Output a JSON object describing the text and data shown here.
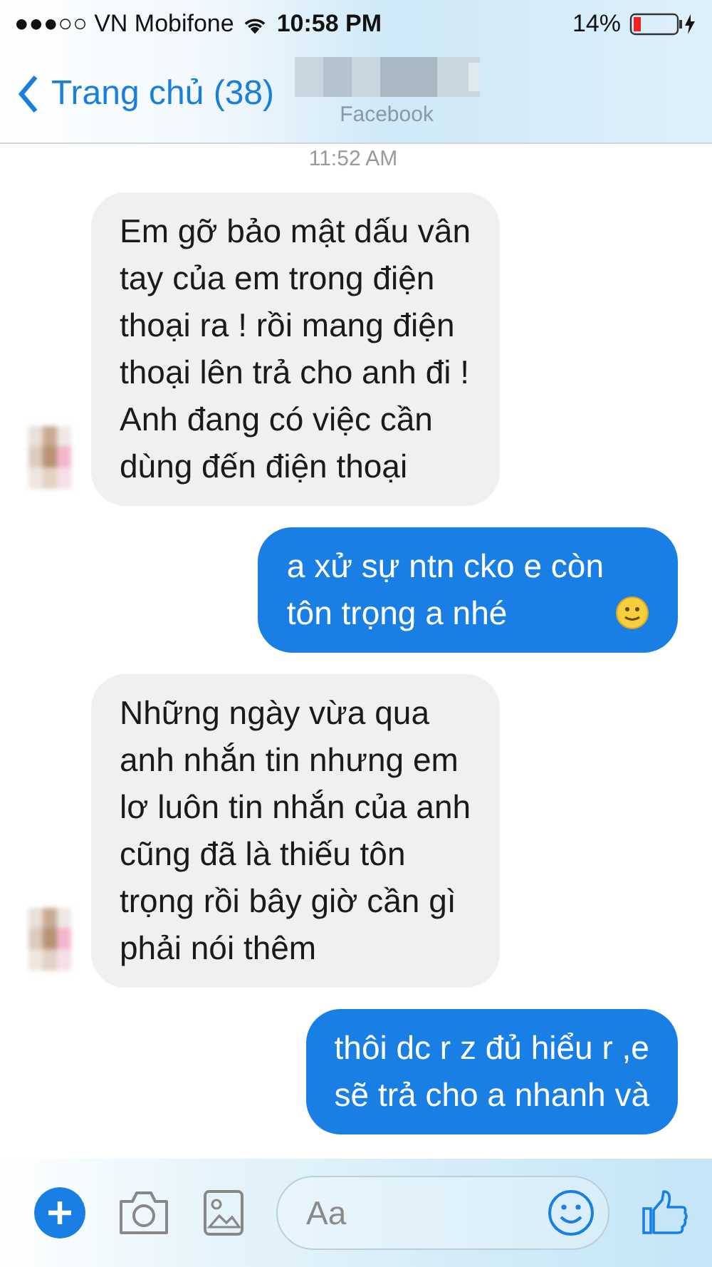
{
  "status_bar": {
    "carrier": "●●●○○ VN Mobifone",
    "time": "10:58 PM",
    "battery": "14%"
  },
  "nav": {
    "back_label": "Trang chủ (38)",
    "subtitle": "Facebook"
  },
  "timestamp": "11:52 AM",
  "messages": [
    {
      "kind": "incoming",
      "text": "Em gỡ bảo mật dấu vân\ntay của em trong điện\nthoại ra ! rồi mang điện\nthoại lên trả cho anh đi !\nAnh đang có việc cần\ndùng đến điện thoại"
    },
    {
      "kind": "outgoing",
      "text": "a xử sự ntn cko e còn\ntôn trọng a nhé",
      "trailing_emoji": true
    },
    {
      "kind": "incoming",
      "text": "Những ngày vừa qua\nanh nhắn tin nhưng em\nlơ luôn tin nhắn của anh\ncũng đã là thiếu tôn\ntrọng rồi bây giờ cần gì\nphải nói thêm"
    },
    {
      "kind": "outgoing",
      "text": "thôi dc r z đủ hiểu r ,e\nsẽ trả cho a nhanh và"
    }
  ],
  "composer": {
    "placeholder": "Aa"
  }
}
